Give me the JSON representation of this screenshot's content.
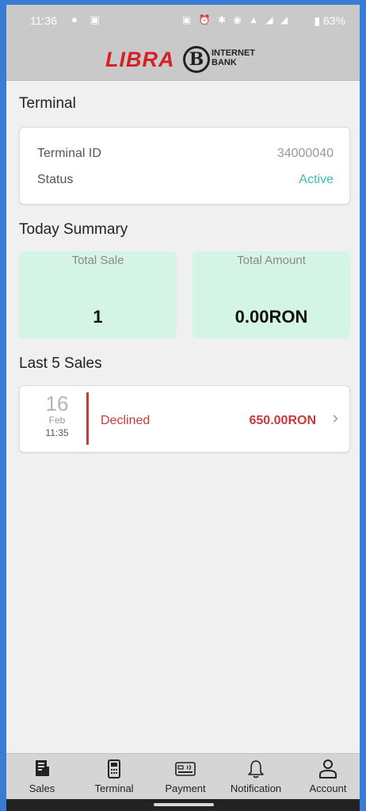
{
  "status_bar": {
    "time": "11:36",
    "battery": "63%"
  },
  "brand": {
    "name": "LIBRA",
    "mark": "B",
    "line1": "INTERNET",
    "line2": "BANK"
  },
  "terminal": {
    "title": "Terminal",
    "rows": [
      {
        "label": "Terminal ID",
        "value": "34000040"
      },
      {
        "label": "Status",
        "value": "Active"
      }
    ]
  },
  "summary": {
    "title": "Today Summary",
    "tiles": [
      {
        "label": "Total Sale",
        "value": "1"
      },
      {
        "label": "Total Amount",
        "value": "0.00RON"
      }
    ]
  },
  "sales": {
    "title": "Last 5 Sales",
    "items": [
      {
        "day": "16",
        "month": "Feb",
        "time": "11:35",
        "status": "Declined",
        "amount": "650.00RON"
      }
    ]
  },
  "nav": {
    "items": [
      {
        "label": "Sales",
        "icon": "sales-receipt-icon"
      },
      {
        "label": "Terminal",
        "icon": "terminal-icon"
      },
      {
        "label": "Payment",
        "icon": "card-payment-icon"
      },
      {
        "label": "Notification",
        "icon": "bell-icon"
      },
      {
        "label": "Account",
        "icon": "user-icon"
      }
    ]
  },
  "colors": {
    "accent_green": "#3cc0a8",
    "tile_bg": "#d4f5e5",
    "declined_red": "#c73a3a",
    "brand_red": "#d42027"
  }
}
